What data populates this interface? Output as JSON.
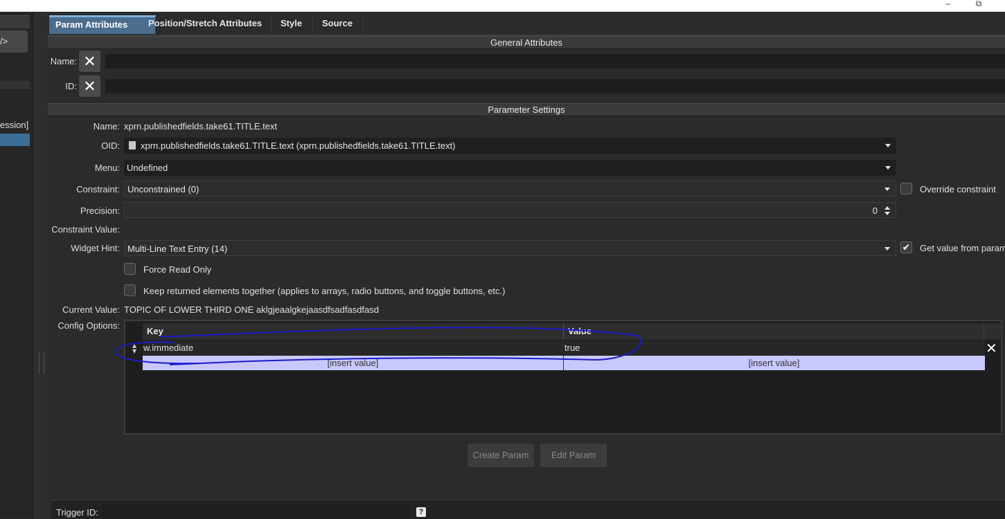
{
  "window": {
    "minimize_icon": "–",
    "restore_icon": "⧉"
  },
  "left": {
    "xml_label": "/>",
    "session_text": "ession]"
  },
  "tabs": [
    "Param Attributes",
    "Position/Stretch Attributes",
    "Style",
    "Source"
  ],
  "general": {
    "title": "General Attributes",
    "name_label": "Name:",
    "id_label": "ID:",
    "name_value": "",
    "id_value": ""
  },
  "params": {
    "title": "Parameter Settings",
    "name_label": "Name:",
    "name_value": "xprn.publishedfields.take61.TITLE.text",
    "oid_label": "OID:",
    "oid_value": "xprn.publishedfields.take61.TITLE.text (xprn.publishedfields.take61.TITLE.text)",
    "menu_label": "Menu:",
    "menu_value": "Undefined",
    "constraint_label": "Constraint:",
    "constraint_value": "Unconstrained (0)",
    "override_label": "Override constraint",
    "precision_label": "Precision:",
    "precision_value": "0",
    "constraint_value_label": "Constraint Value:",
    "widget_hint_label": "Widget Hint:",
    "widget_hint_value": "Multi-Line Text Entry (14)",
    "get_value_label": "Get value from param",
    "force_read_only_label": "Force Read Only",
    "keep_together_label": "Keep returned elements together (applies to arrays, radio buttons, and toggle buttons, etc.)",
    "current_value_label": "Current Value:",
    "current_value": "TOPIC OF LOWER THIRD ONE aklgjeaalgkejaasdfsadfasdfasd",
    "config_options_label": "Config Options:"
  },
  "config_table": {
    "headers": [
      "Key",
      "Value"
    ],
    "rows": [
      {
        "key": "w.immediate",
        "value": "true"
      }
    ],
    "insert_placeholder": "[insert value]"
  },
  "buttons": {
    "create": "Create Param",
    "edit": "Edit Param"
  },
  "footer": {
    "trigger_label": "Trigger ID:",
    "help": "?"
  },
  "colors": {
    "tab_active": "#4b6d8e",
    "insert_row": "#c8c8ff",
    "annotation": "#1a1acc"
  }
}
